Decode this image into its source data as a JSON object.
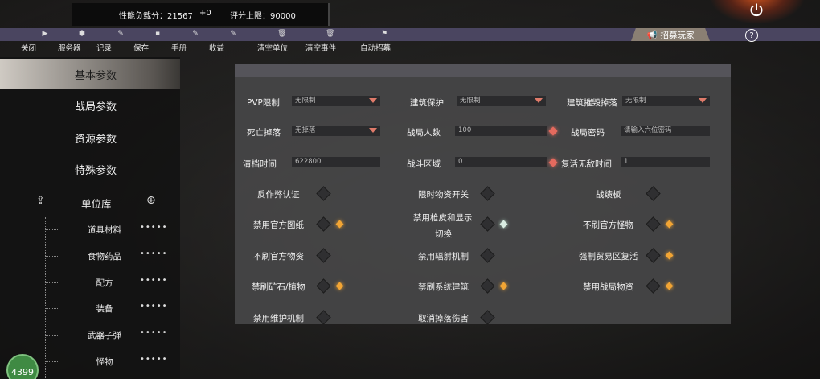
{
  "topbar": {
    "perf_label": "性能负载分：21567",
    "perf_delta": "+0",
    "limit_label": "评分上限：90000"
  },
  "toolbar": {
    "items": [
      {
        "label": "关闭",
        "icon": "play-icon"
      },
      {
        "label": "服务器",
        "icon": "cube-icon"
      },
      {
        "label": "记录",
        "icon": "edit-icon"
      },
      {
        "label": "保存",
        "icon": "save-icon"
      },
      {
        "label": "手册",
        "icon": "book-icon"
      },
      {
        "label": "收益",
        "icon": "ledger-icon"
      },
      {
        "label": "清空单位",
        "icon": "trash-icon"
      },
      {
        "label": "清空事件",
        "icon": "trash-icon"
      },
      {
        "label": "自动招募",
        "icon": "flag-icon"
      }
    ],
    "recruit_label": "招募玩家"
  },
  "sidebar": {
    "items": [
      {
        "label": "基本参数"
      },
      {
        "label": "战局参数"
      },
      {
        "label": "资源参数"
      },
      {
        "label": "特殊参数"
      }
    ],
    "unit_lib": "单位库",
    "sub_items": [
      "道具材料",
      "食物药品",
      "配方",
      "装备",
      "武器子弹",
      "怪物"
    ],
    "sub_dots": "•••••",
    "badge": "4399"
  },
  "form": {
    "pvp": {
      "label": "PVP限制",
      "value": "无限制"
    },
    "build_protect": {
      "label": "建筑保护",
      "value": "无限制"
    },
    "build_drop": {
      "label": "建筑摧毁掉落",
      "value": "无限制"
    },
    "death_drop": {
      "label": "死亡掉落",
      "value": "无掉落"
    },
    "players": {
      "label": "战局人数",
      "value": "100"
    },
    "password": {
      "label": "战局密码",
      "placeholder": "请输入六位密码"
    },
    "wipe_time": {
      "label": "清档时间",
      "value": "622800"
    },
    "combat_zone": {
      "label": "战斗区域",
      "value": "0"
    },
    "respawn_invuln": {
      "label": "复活无敌时间",
      "value": "1"
    },
    "toggles": [
      {
        "label": "反作弊认证",
        "on": false
      },
      {
        "label": "限时物资开关",
        "on": false
      },
      {
        "label": "战绩板",
        "on": false
      },
      {
        "label": "禁用官方图纸",
        "on": true
      },
      {
        "label": "禁用枪皮和显示",
        "label2": "切换",
        "on": true,
        "color": "white"
      },
      {
        "label": "不刷官方怪物",
        "on": true
      },
      {
        "label": "不刷官方物资",
        "on": false
      },
      {
        "label": "禁用辐射机制",
        "on": false
      },
      {
        "label": "强制贸易区复活",
        "on": true
      },
      {
        "label": "禁刷矿石/植物",
        "on": true
      },
      {
        "label": "禁刷系统建筑",
        "on": true
      },
      {
        "label": "禁用战局物资",
        "on": true
      },
      {
        "label": "禁用维护机制",
        "on": false
      },
      {
        "label": "取消掉落伤害",
        "on": false
      }
    ]
  }
}
